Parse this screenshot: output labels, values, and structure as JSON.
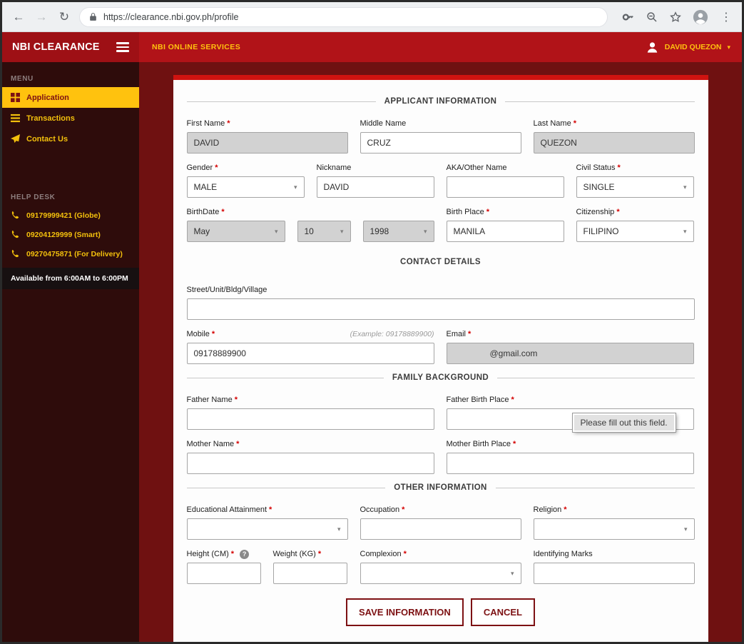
{
  "theme": {
    "header_red": "#b11318",
    "brand_red": "#9e1015",
    "sidebar_bg": "#2e0c0b",
    "page_bg": "#6f1111",
    "accent_yellow": "#ffc20e",
    "maroon": "#7d1113",
    "card_top_strip": "#cf1310"
  },
  "glyphs": {
    "back": "←",
    "forward": "→",
    "refresh": "↻",
    "kebab": "⋮",
    "caret_down": "▾",
    "required": "*",
    "help": "?"
  },
  "browser": {
    "url": "https://clearance.nbi.gov.ph/profile"
  },
  "header": {
    "brand": "NBI CLEARANCE",
    "title": "NBI ONLINE SERVICES",
    "user": "DAVID QUEZON"
  },
  "sidebar": {
    "menu_label": "MENU",
    "items": [
      {
        "label": "Application"
      },
      {
        "label": "Transactions"
      },
      {
        "label": "Contact Us"
      }
    ],
    "helpdesk_label": "HELP DESK",
    "phones": [
      "09179999421 (Globe)",
      "09204129999 (Smart)",
      "09270475871 (For Delivery)"
    ],
    "availability": "Available from 6:00AM to 6:00PM"
  },
  "form": {
    "sections": {
      "applicant": "APPLICANT INFORMATION",
      "contact": "CONTACT DETAILS",
      "family": "FAMILY BACKGROUND",
      "other": "OTHER INFORMATION"
    },
    "fields": {
      "first_name": {
        "label": "First Name",
        "value": "DAVID"
      },
      "middle_name": {
        "label": "Middle Name",
        "value": "CRUZ"
      },
      "last_name": {
        "label": "Last Name",
        "value": "QUEZON"
      },
      "gender": {
        "label": "Gender",
        "value": "MALE"
      },
      "nickname": {
        "label": "Nickname",
        "value": "DAVID"
      },
      "aka": {
        "label": "AKA/Other Name",
        "value": ""
      },
      "civil_status": {
        "label": "Civil Status",
        "value": "SINGLE"
      },
      "birthdate": {
        "label": "BirthDate",
        "month": "May",
        "day": "10",
        "year": "1998"
      },
      "birth_place": {
        "label": "Birth Place",
        "value": "MANILA"
      },
      "citizenship": {
        "label": "Citizenship",
        "value": "FILIPINO"
      },
      "street": {
        "label": "Street/Unit/Bldg/Village",
        "value": ""
      },
      "mobile": {
        "label": "Mobile",
        "value": "09178889900",
        "hint": "(Example: 09178889900)"
      },
      "email": {
        "label": "Email",
        "value": "@gmail.com"
      },
      "father_name": {
        "label": "Father Name",
        "value": ""
      },
      "father_birth_place": {
        "label": "Father Birth Place",
        "value": ""
      },
      "mother_name": {
        "label": "Mother Name",
        "value": ""
      },
      "mother_birth_place": {
        "label": "Mother Birth Place",
        "value": ""
      },
      "educational_attainment": {
        "label": "Educational Attainment",
        "value": ""
      },
      "occupation": {
        "label": "Occupation",
        "value": ""
      },
      "religion": {
        "label": "Religion",
        "value": ""
      },
      "height": {
        "label": "Height (CM)",
        "value": ""
      },
      "weight": {
        "label": "Weight (KG)",
        "value": ""
      },
      "complexion": {
        "label": "Complexion",
        "value": ""
      },
      "identifying_marks": {
        "label": "Identifying Marks",
        "value": ""
      }
    },
    "tooltip": "Please fill out this field.",
    "buttons": {
      "save": "SAVE INFORMATION",
      "cancel": "CANCEL"
    }
  }
}
